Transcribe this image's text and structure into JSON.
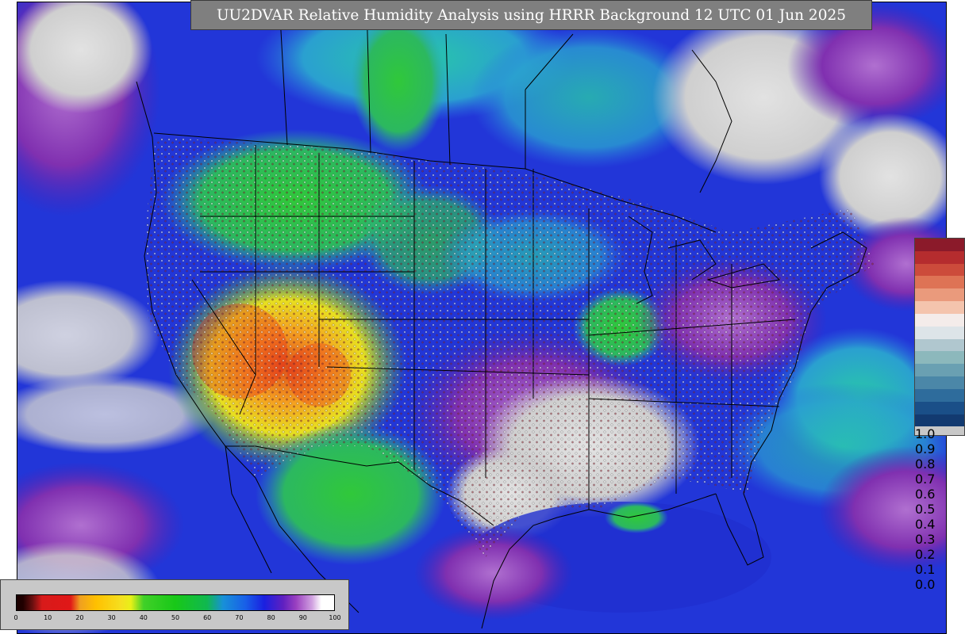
{
  "title": "UU2DVAR Relative Humidity Analysis using HRRR Background 12 UTC 01 Jun 2025",
  "map_layers": {
    "basemap": "continental-us-rh-analysis",
    "land_boundaries": "state-and-country-borders",
    "observation_markers": "circle-markers-colored-by-value"
  },
  "obs_legend": {
    "labels": [
      "1.0",
      "0.9",
      "0.8",
      "0.7",
      "0.6",
      "0.5",
      "0.4",
      "0.3",
      "0.2",
      "0.1",
      "0.0"
    ],
    "colors": [
      "#8b1a2a",
      "#b52c2e",
      "#cc4b3b",
      "#de7355",
      "#ea9a7c",
      "#f4c4ad",
      "#f4ecea",
      "#dde4e8",
      "#b0c7cf",
      "#8cb8bc",
      "#6aa0b2",
      "#4b87a8",
      "#2e6c9c",
      "#1a4f88",
      "#123a70"
    ]
  },
  "rh_colorbar": {
    "ticks": [
      "0",
      "10",
      "20",
      "30",
      "40",
      "50",
      "60",
      "70",
      "80",
      "90",
      "100"
    ],
    "min": 0,
    "max": 100
  },
  "colors": {
    "frame_gray": "#c8c8c8",
    "title_bg": "#7f7f7f",
    "ocean_blue": "#1a2bd8",
    "dry_red": "#d61a1a"
  }
}
